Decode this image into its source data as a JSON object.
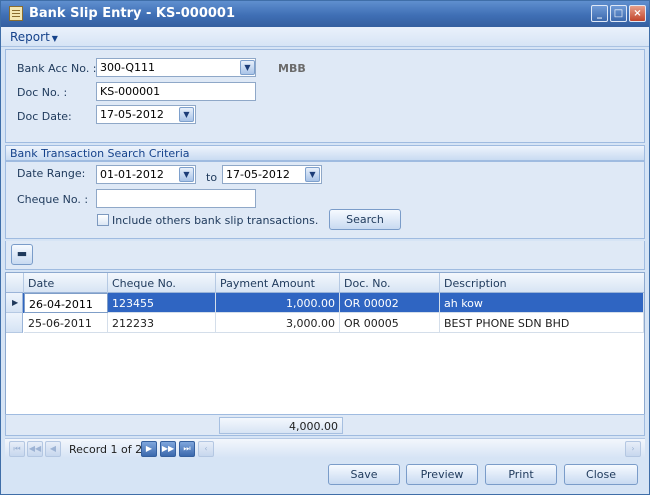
{
  "window": {
    "title": "Bank Slip Entry - KS-000001"
  },
  "menu": {
    "report_label": "Report"
  },
  "header": {
    "bank_acc_label": "Bank Acc No. :",
    "bank_acc_value": "300-Q111",
    "bank_code": "MBB",
    "doc_no_label": "Doc No. :",
    "doc_no_value": "KS-000001",
    "doc_date_label": "Doc Date:",
    "doc_date_value": "17-05-2012"
  },
  "search": {
    "section_title": "Bank Transaction Search Criteria",
    "date_range_label": "Date Range:",
    "date_from": "01-01-2012",
    "to_label": "to",
    "date_to": "17-05-2012",
    "cheque_label": "Cheque No. :",
    "cheque_value": "",
    "include_label": "Include others bank slip transactions.",
    "search_button": "Search"
  },
  "grid": {
    "columns": [
      "Date",
      "Cheque No.",
      "Payment Amount",
      "Doc. No.",
      "Description"
    ],
    "rows": [
      {
        "date": "26-04-2011",
        "cheque": "123455",
        "amount": "1,000.00",
        "doc": "OR 00002",
        "description": "ah kow"
      },
      {
        "date": "25-06-2011",
        "cheque": "212233",
        "amount": "3,000.00",
        "doc": "OR 00005",
        "description": "BEST PHONE SDN BHD"
      }
    ],
    "total": "4,000.00"
  },
  "navigator": {
    "record_text": "Record 1 of 2"
  },
  "buttons": {
    "save": "Save",
    "preview": "Preview",
    "print": "Print",
    "close": "Close"
  }
}
